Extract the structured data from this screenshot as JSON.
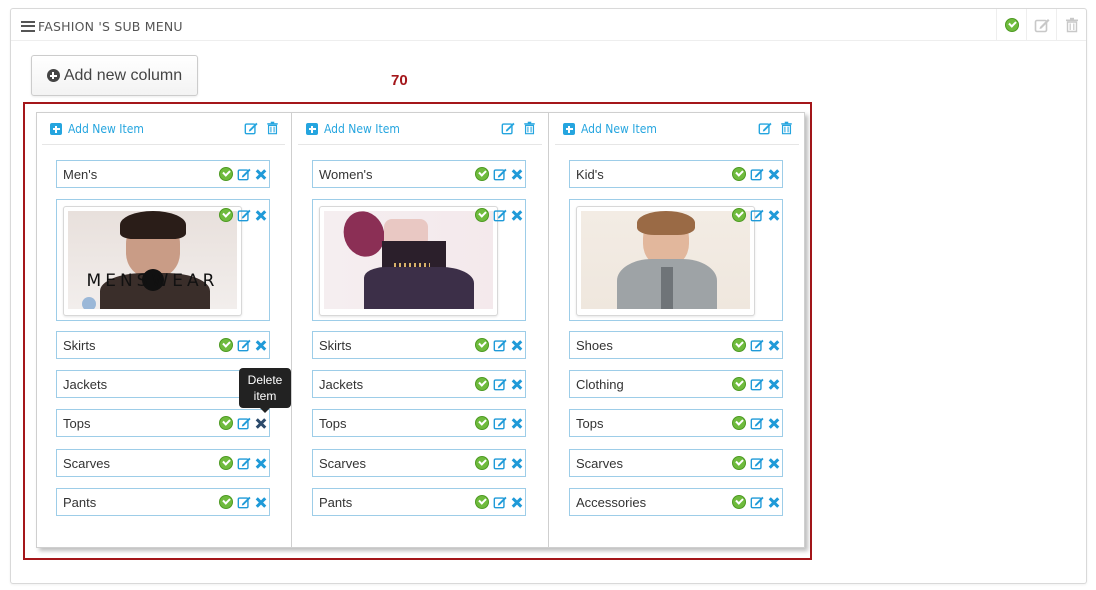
{
  "panel": {
    "title": "FASHION 'S SUB MENU",
    "actions": [
      "confirm-icon",
      "edit-icon",
      "trash-icon"
    ]
  },
  "toolbar": {
    "add_column_label": "Add new column",
    "column_count": "70"
  },
  "columns": [
    {
      "add_item_label": "Add New Item",
      "items": [
        {
          "label": "Men's",
          "type": "text"
        },
        {
          "label": "MENSWEAR",
          "type": "image"
        },
        {
          "label": "Skirts",
          "type": "text"
        },
        {
          "label": "Jackets",
          "type": "text"
        },
        {
          "label": "Tops",
          "type": "text"
        },
        {
          "label": "Scarves",
          "type": "text"
        },
        {
          "label": "Pants",
          "type": "text"
        }
      ]
    },
    {
      "add_item_label": "Add New Item",
      "items": [
        {
          "label": "Women's",
          "type": "text"
        },
        {
          "label": "",
          "type": "image"
        },
        {
          "label": "Skirts",
          "type": "text"
        },
        {
          "label": "Jackets",
          "type": "text"
        },
        {
          "label": "Tops",
          "type": "text"
        },
        {
          "label": "Scarves",
          "type": "text"
        },
        {
          "label": "Pants",
          "type": "text"
        }
      ]
    },
    {
      "add_item_label": "Add New Item",
      "items": [
        {
          "label": "Kid's",
          "type": "text"
        },
        {
          "label": "",
          "type": "image"
        },
        {
          "label": "Shoes",
          "type": "text"
        },
        {
          "label": "Clothing",
          "type": "text"
        },
        {
          "label": "Tops",
          "type": "text"
        },
        {
          "label": "Scarves",
          "type": "text"
        },
        {
          "label": "Accessories",
          "type": "text"
        }
      ]
    }
  ],
  "tooltip": {
    "text_line1": "Delete",
    "text_line2": "item"
  },
  "colors": {
    "accent_blue": "#25a5df",
    "highlight_red": "#a4161a",
    "check_green": "#6fbb3d"
  }
}
